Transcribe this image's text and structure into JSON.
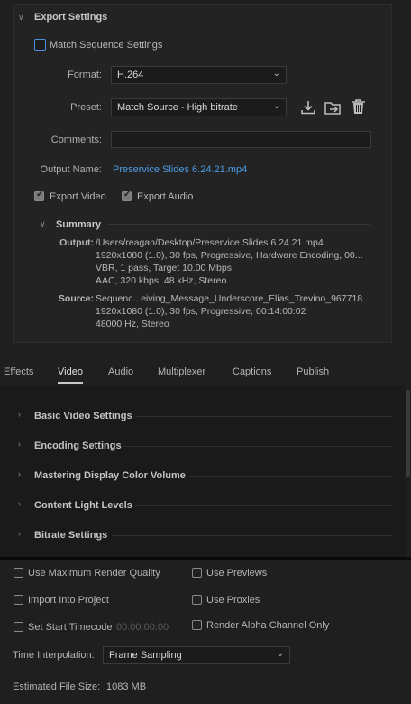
{
  "export_settings": {
    "title": "Export Settings",
    "match_sequence_label": "Match Sequence Settings",
    "format_label": "Format:",
    "format_value": "H.264",
    "preset_label": "Preset:",
    "preset_value": "Match Source - High bitrate",
    "comments_label": "Comments:",
    "comments_value": "",
    "output_name_label": "Output Name:",
    "output_name_value": "Preservice Slides 6.24.21.mp4",
    "export_video_label": "Export Video",
    "export_audio_label": "Export Audio",
    "export_video_checked": true,
    "export_audio_checked": true
  },
  "summary": {
    "title": "Summary",
    "output_label": "Output:",
    "output_lines": [
      "/Users/reagan/Desktop/Preservice Slides 6.24.21.mp4",
      "1920x1080 (1.0), 30 fps, Progressive, Hardware Encoding, 00...",
      "VBR, 1 pass, Target 10.00 Mbps",
      "AAC, 320 kbps, 48 kHz, Stereo"
    ],
    "source_label": "Source:",
    "source_lines": [
      "Sequenc...eiving_Message_Underscore_Elias_Trevino_967718",
      "1920x1080 (1.0), 30 fps, Progressive, 00:14:00:02",
      "48000 Hz, Stereo"
    ]
  },
  "tabs": [
    {
      "label": "Effects",
      "active": false
    },
    {
      "label": "Video",
      "active": true
    },
    {
      "label": "Audio",
      "active": false
    },
    {
      "label": "Multiplexer",
      "active": false
    },
    {
      "label": "Captions",
      "active": false
    },
    {
      "label": "Publish",
      "active": false
    }
  ],
  "video_sections": [
    "Basic Video Settings",
    "Encoding Settings",
    "Mastering Display Color Volume",
    "Content Light Levels",
    "Bitrate Settings"
  ],
  "options": {
    "max_render_quality": "Use Maximum Render Quality",
    "use_previews": "Use Previews",
    "import_into_project": "Import Into Project",
    "use_proxies": "Use Proxies",
    "set_start_timecode": "Set Start Timecode",
    "timecode_value": "00:00:00:00",
    "render_alpha": "Render Alpha Channel Only",
    "time_interp_label": "Time Interpolation:",
    "time_interp_value": "Frame Sampling",
    "file_size_label": "Estimated File Size:",
    "file_size_value": "1083 MB"
  },
  "icons": {
    "save_preset": "download-icon",
    "import_preset": "folder-import-icon",
    "delete_preset": "trash-icon",
    "link_color": "#4f9ce6",
    "checkbox_accent": "#4a8fe2"
  }
}
